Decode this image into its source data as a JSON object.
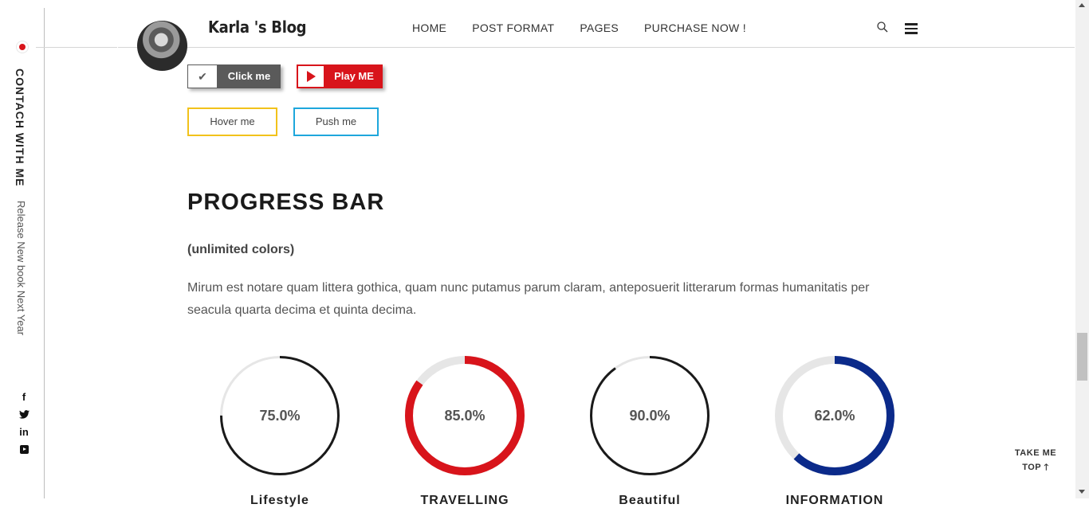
{
  "sidebar": {
    "contact_label": "CONTACH WITH ME",
    "tagline": "Release New book Next Year",
    "social": [
      {
        "icon": "facebook-icon",
        "glyph": "f"
      },
      {
        "icon": "twitter-icon",
        "glyph": "🐦"
      },
      {
        "icon": "linkedin-icon",
        "glyph": "in"
      },
      {
        "icon": "youtube-icon",
        "glyph": ""
      }
    ],
    "accent": "#d8141b"
  },
  "header": {
    "brand": "Karla 's Blog",
    "nav": [
      "HOME",
      "POST FORMAT",
      "PAGES",
      "PURCHASE NOW !"
    ]
  },
  "buttons": {
    "click_label": "Click me",
    "play_label": "Play ME",
    "hover_label": "Hover me",
    "push_label": "Push me"
  },
  "section": {
    "title": "PROGRESS BAR",
    "subtitle": "(unlimited colors)",
    "paragraph": "Mirum est notare quam littera gothica, quam nunc putamus parum claram, anteposuerit litterarum formas humanitatis per seacula quarta decima et quinta decima."
  },
  "progress": [
    {
      "label": "Lifestyle",
      "value": 75.0,
      "display": "75.0%",
      "color": "#1a1a1a",
      "track": "#e6e6e6",
      "thick": false
    },
    {
      "label": "TRAVELLING",
      "value": 85.0,
      "display": "85.0%",
      "color": "#d8141b",
      "track": "#e6e6e6",
      "thick": true
    },
    {
      "label": "Beautiful",
      "value": 90.0,
      "display": "90.0%",
      "color": "#1a1a1a",
      "track": "#e6e6e6",
      "thick": false
    },
    {
      "label": "INFORMATION",
      "value": 62.0,
      "display": "62.0%",
      "color": "#0b2a8a",
      "track": "#e6e6e6",
      "thick": true
    }
  ],
  "totop": {
    "line1": "TAKE ME",
    "line2": "TOP"
  }
}
